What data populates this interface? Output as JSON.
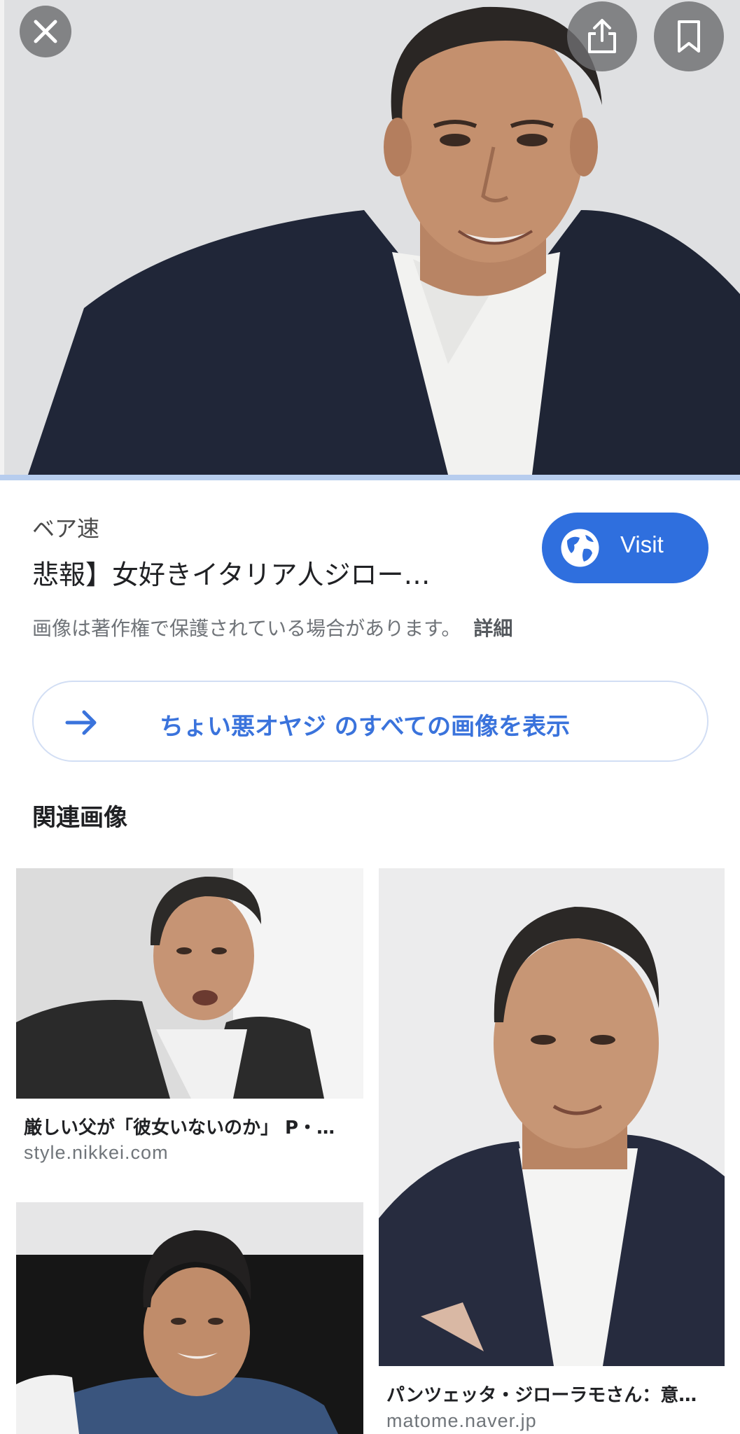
{
  "hero": {
    "image_icon": "portrait-photo",
    "close_icon": "close-icon",
    "share_icon": "share-icon",
    "bookmark_icon": "bookmark-icon"
  },
  "result": {
    "source": "ベア速",
    "title": "悲報】女好きイタリア人ジロー…",
    "visit_label": "Visit",
    "copyright_notice": "画像は著作権で保護されている場合があります。",
    "detail_link": "詳細"
  },
  "view_all": {
    "label": "ちょい悪オヤジ のすべての画像を表示"
  },
  "related": {
    "heading": "関連画像",
    "items": [
      {
        "caption": "厳しい父が「彼女いないのか」 P・…",
        "domain": "style.nikkei.com"
      },
      {
        "caption": "パンツェッタ・ジローラモさん：意…",
        "domain": "matome.naver.jp"
      },
      {
        "caption": "",
        "domain": ""
      }
    ]
  },
  "colors": {
    "accent": "#2f6fde",
    "link_text": "#3a73dc",
    "hero_border": "#b7cdee"
  }
}
